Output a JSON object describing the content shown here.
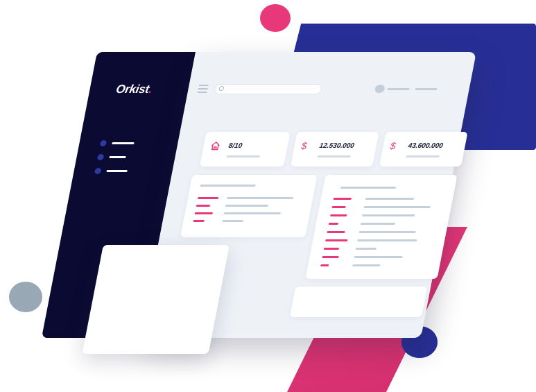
{
  "app": {
    "logo_text": "Orkist",
    "logo_dot": "."
  },
  "colors": {
    "sidebar": "#0b0a33",
    "main_bg": "#eef2f7",
    "card": "#ffffff",
    "accent_pink": "#e8387a",
    "accent_blue": "#272f96",
    "muted": "#c5d0db"
  },
  "header": {
    "menu_icon": "hamburger-icon",
    "search": {
      "icon": "search-icon",
      "placeholder": "",
      "value": ""
    },
    "user": {
      "avatar": "avatar"
    }
  },
  "stats": [
    {
      "icon": "home-icon",
      "value": "8/10"
    },
    {
      "icon": "dollar-icon",
      "value": "12.530.000"
    },
    {
      "icon": "dollar-icon",
      "value": "43.600.000"
    }
  ],
  "sidebar": {
    "items": 3
  }
}
